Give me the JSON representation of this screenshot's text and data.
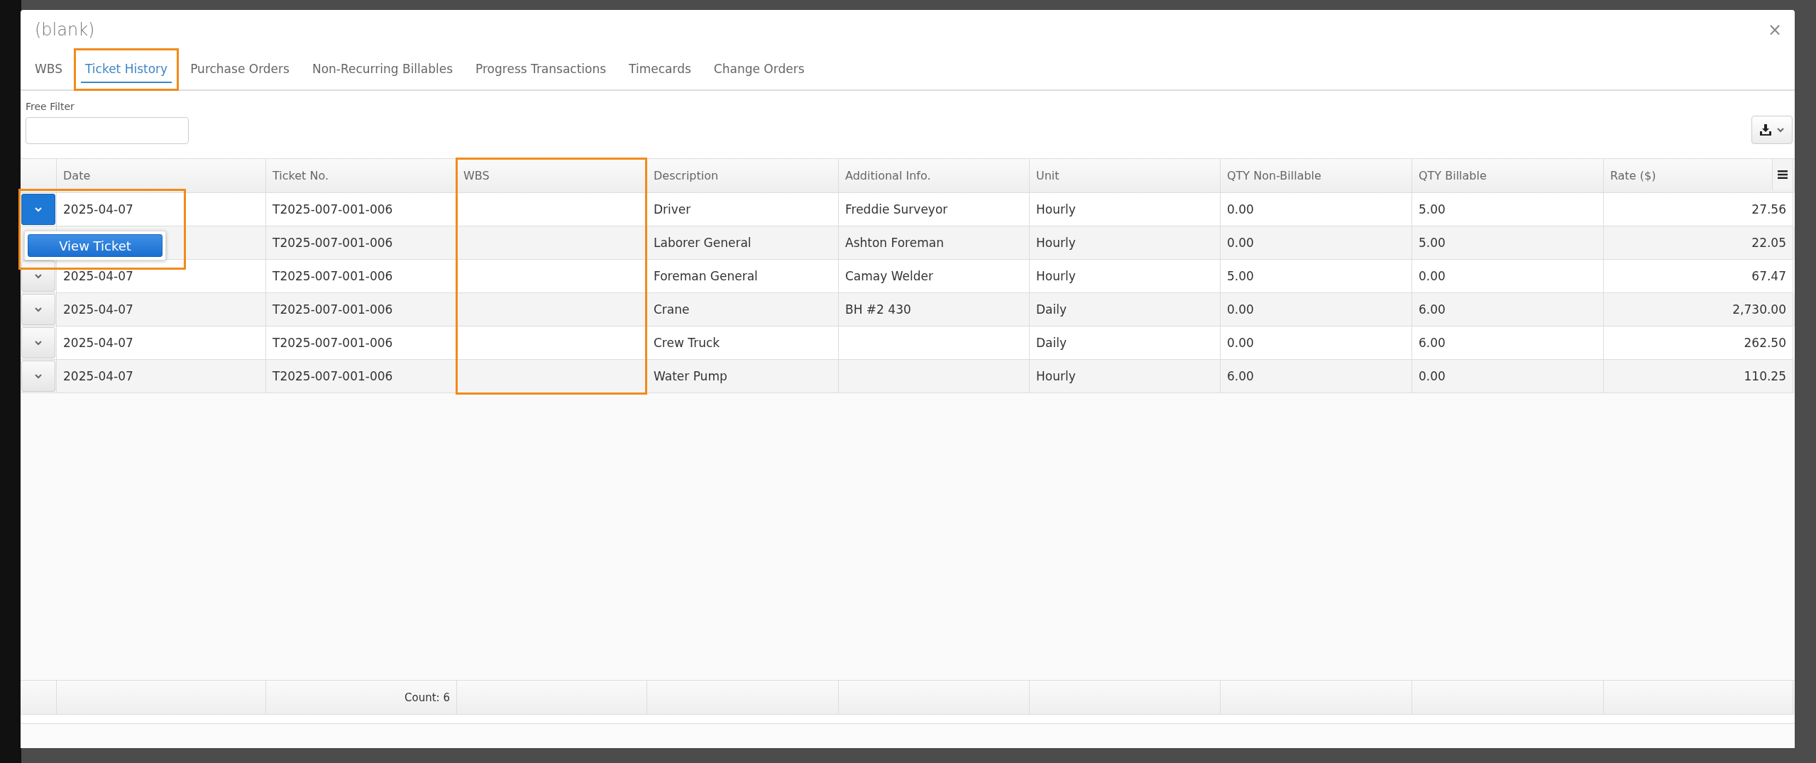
{
  "dialog": {
    "title": "(blank)",
    "close": "×"
  },
  "tabs": [
    {
      "label": "WBS",
      "selected": false,
      "highlighted": false
    },
    {
      "label": "Ticket History",
      "selected": true,
      "highlighted": true
    },
    {
      "label": "Purchase Orders",
      "selected": false,
      "highlighted": false
    },
    {
      "label": "Non-Recurring Billables",
      "selected": false,
      "highlighted": false
    },
    {
      "label": "Progress Transactions",
      "selected": false,
      "highlighted": false
    },
    {
      "label": "Timecards",
      "selected": false,
      "highlighted": false
    },
    {
      "label": "Change Orders",
      "selected": false,
      "highlighted": false
    }
  ],
  "filter": {
    "label": "Free Filter"
  },
  "table": {
    "columns": [
      {
        "label": "Date",
        "kind": "text",
        "highlighted": false
      },
      {
        "label": "Ticket No.",
        "kind": "text",
        "highlighted": false
      },
      {
        "label": "WBS",
        "kind": "text",
        "highlighted": true
      },
      {
        "label": "Description",
        "kind": "text",
        "highlighted": false
      },
      {
        "label": "Additional Info.",
        "kind": "text",
        "highlighted": false
      },
      {
        "label": "Unit",
        "kind": "text",
        "highlighted": false
      },
      {
        "label": "QTY Non-Billable",
        "kind": "text",
        "highlighted": false
      },
      {
        "label": "QTY Billable",
        "kind": "text",
        "highlighted": false
      },
      {
        "label": "Rate ($)",
        "kind": "amount",
        "highlighted": false
      }
    ],
    "rows": [
      {
        "expanded": true,
        "date": "2025-04-07",
        "ticket_no": "T2025-007-001-006",
        "description": "Driver",
        "additional_info": "Freddie Surveyor",
        "unit": "Hourly",
        "qty_non_billable": "0.00",
        "qty_billable": "5.00",
        "rate": "27.56",
        "menu": {
          "highlighted": true,
          "items": [
            "View Ticket"
          ]
        }
      },
      {
        "ticket_no": "T2025-007-001-006",
        "description": "Laborer General",
        "additional_info": "Ashton Foreman",
        "unit": "Hourly",
        "qty_non_billable": "0.00",
        "qty_billable": "5.00",
        "rate": "22.05"
      },
      {
        "expanded": false,
        "date": "2025-04-07",
        "ticket_no": "T2025-007-001-006",
        "description": "Foreman General",
        "additional_info": "Camay Welder",
        "unit": "Hourly",
        "qty_non_billable": "5.00",
        "qty_billable": "0.00",
        "rate": "67.47"
      },
      {
        "expanded": false,
        "date": "2025-04-07",
        "ticket_no": "T2025-007-001-006",
        "description": "Crane",
        "additional_info": "BH #2 430",
        "unit": "Daily",
        "qty_non_billable": "0.00",
        "qty_billable": "6.00",
        "rate": "2,730.00"
      },
      {
        "expanded": false,
        "date": "2025-04-07",
        "ticket_no": "T2025-007-001-006",
        "description": "Crew Truck",
        "unit": "Daily",
        "qty_non_billable": "0.00",
        "qty_billable": "6.00",
        "rate": "262.50"
      },
      {
        "expanded": false,
        "date": "2025-04-07",
        "ticket_no": "T2025-007-001-006",
        "description": "Water Pump",
        "unit": "Hourly",
        "qty_non_billable": "6.00",
        "qty_billable": "0.00",
        "rate": "110.25"
      }
    ],
    "footer": {
      "count": "Count: 6"
    }
  }
}
